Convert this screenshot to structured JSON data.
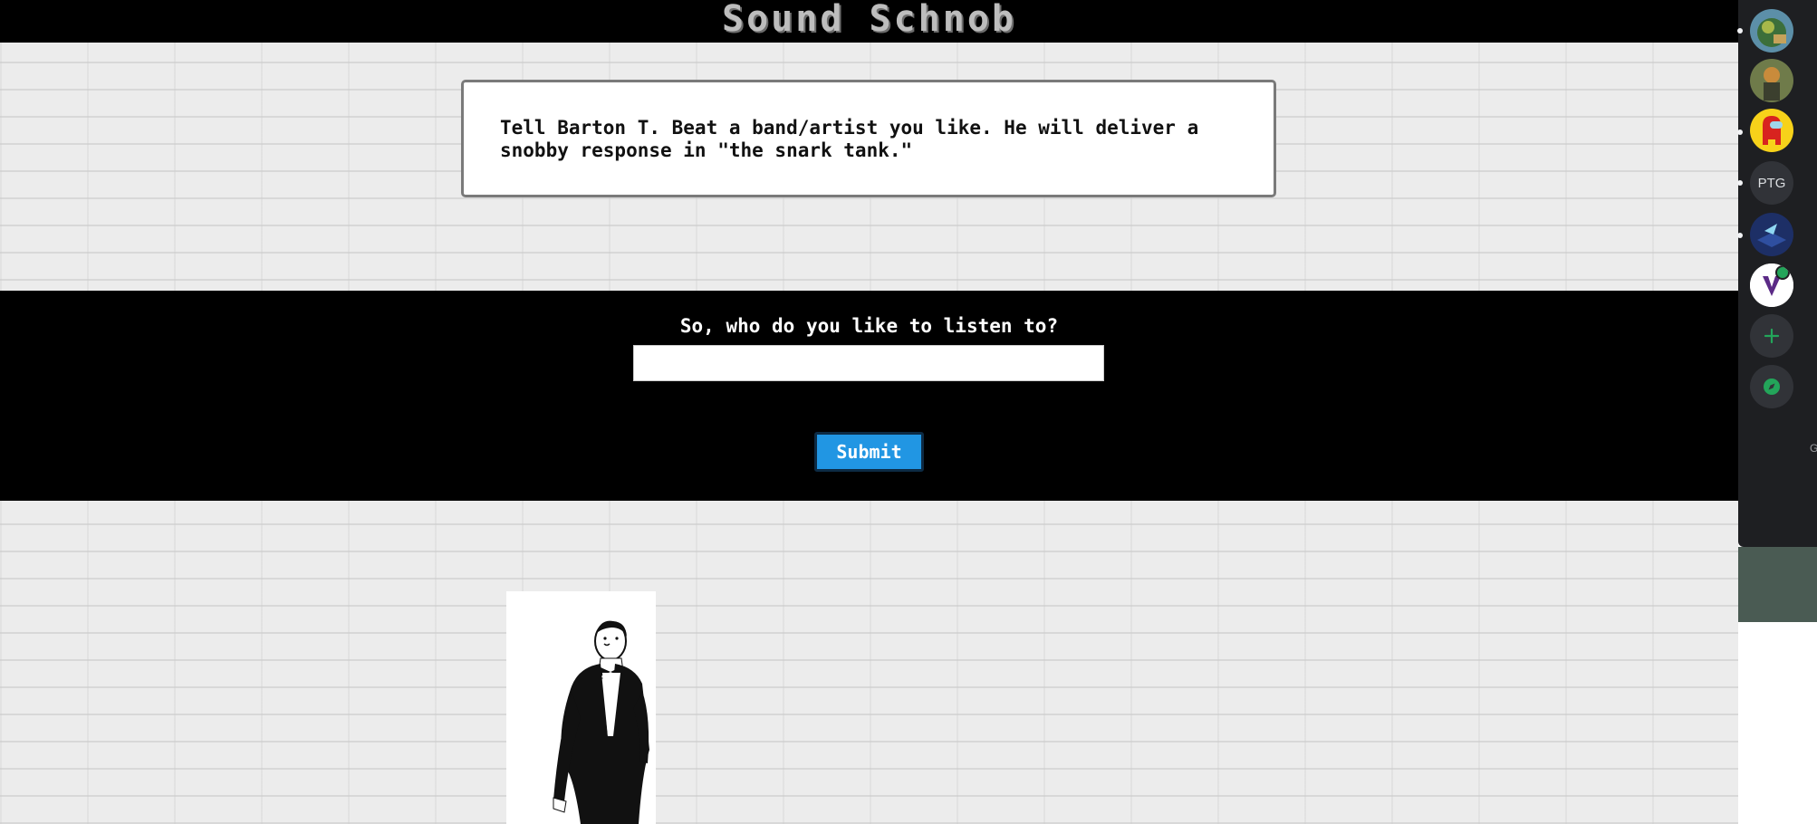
{
  "header": {
    "site_title": "Sound Schnob"
  },
  "intro": {
    "text": "Tell Barton T. Beat a band/artist you like. He will deliver a snobby response in \"the snark tank.\""
  },
  "form": {
    "prompt": "So, who do you like to listen to?",
    "input_value": "",
    "input_placeholder": "",
    "submit_label": "Submit"
  },
  "sidebar": {
    "servers": [
      {
        "name": "server-avatar-1",
        "kind": "image",
        "colors": [
          "#3c6f3a",
          "#a8b84a",
          "#5c8fa8"
        ]
      },
      {
        "name": "server-avatar-2",
        "kind": "image",
        "colors": [
          "#3b3f2e",
          "#c98b3b",
          "#6f7b4a"
        ]
      },
      {
        "name": "server-avatar-3",
        "kind": "image",
        "colors": [
          "#f7d21a",
          "#d8231f"
        ]
      },
      {
        "name": "server-ptg",
        "kind": "text",
        "label": "PTG"
      },
      {
        "name": "server-avatar-5",
        "kind": "image",
        "colors": [
          "#2f4fa0",
          "#8fd7f2"
        ]
      },
      {
        "name": "server-avatar-6",
        "kind": "image",
        "colors": [
          "#ffffff",
          "#5b2a86"
        ]
      }
    ],
    "add_server_icon": "plus-icon",
    "explore_icon": "compass-icon",
    "edge_glyph": "G"
  },
  "colors": {
    "accent": "#2196e3",
    "discord_green": "#23a55a",
    "title_gray": "#bdbdbd"
  }
}
